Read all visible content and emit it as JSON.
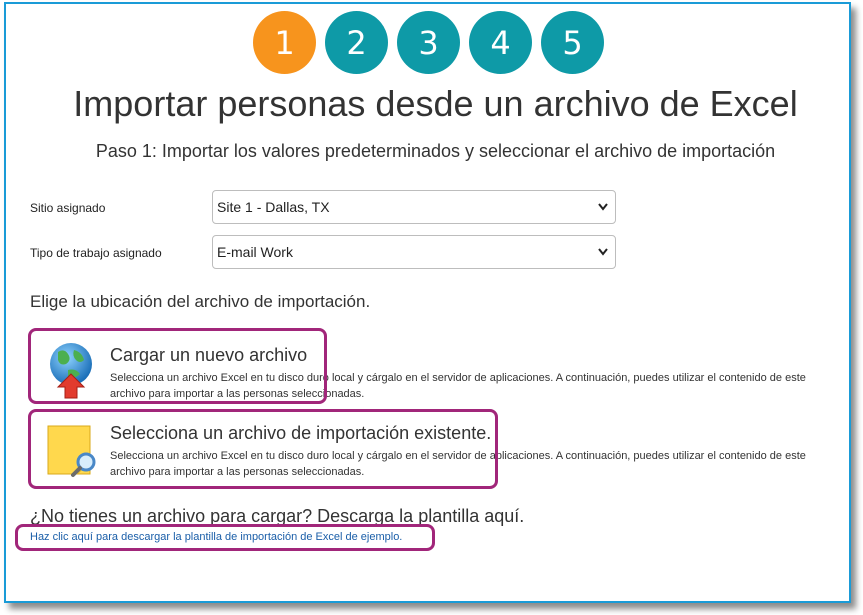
{
  "steps": [
    {
      "label": "1",
      "active": true
    },
    {
      "label": "2",
      "active": false
    },
    {
      "label": "3",
      "active": false
    },
    {
      "label": "4",
      "active": false
    },
    {
      "label": "5",
      "active": false
    }
  ],
  "title": "Importar personas desde un archivo de Excel",
  "subtitle": "Paso 1: Importar los valores predeterminados y seleccionar el archivo de importación",
  "form": {
    "site_label": "Sitio asignado",
    "site_value": "Site 1 - Dallas, TX",
    "worktype_label": "Tipo de trabajo asignado",
    "worktype_value": "E-mail Work"
  },
  "location_heading": "Elige la ubicación del archivo de importación.",
  "options": [
    {
      "icon": "globe-upload-icon",
      "title": "Cargar un nuevo archivo",
      "description": "Selecciona un archivo Excel en tu disco duro local y cárgalo en el servidor de aplicaciones. A continuación, puedes utilizar el contenido de este archivo para importar a las personas seleccionadas."
    },
    {
      "icon": "file-search-icon",
      "title": "Selecciona un archivo de importación existente.",
      "description": "Selecciona un archivo Excel en tu disco duro local y cárgalo en el servidor de aplicaciones. A continuación, puedes utilizar el contenido de este archivo para importar a las personas seleccionadas."
    }
  ],
  "template": {
    "prompt": "¿No tienes un archivo para cargar? Descarga la plantilla aquí.",
    "link_text": "Haz clic aquí para descargar la plantilla de importación de Excel de ejemplo."
  },
  "colors": {
    "step_active": "#f7941d",
    "step_inactive": "#0e9aa7",
    "highlight": "#a1267a",
    "frame_border": "#1a9bd7",
    "link": "#1a5ea8"
  }
}
